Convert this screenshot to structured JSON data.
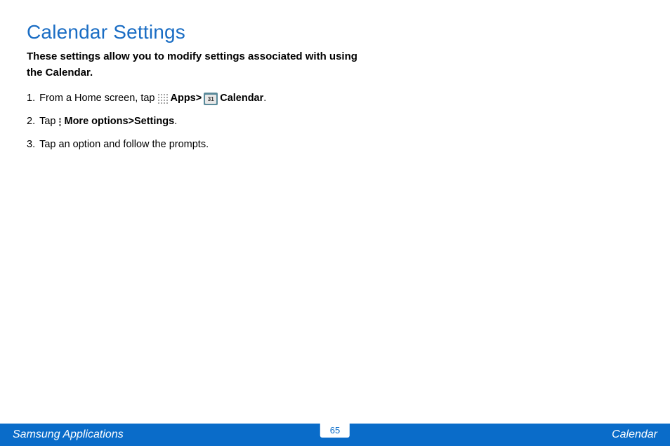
{
  "title": "Calendar Settings",
  "intro": "These settings allow you to modify settings associated with using the Calendar.",
  "steps": {
    "s1": {
      "num": "1.",
      "lead": " From a Home screen, tap ",
      "apps": "Apps",
      "gt": " > ",
      "cal_badge": "31",
      "calendar": "Calendar",
      "period": "."
    },
    "s2": {
      "num": "2.",
      "lead": " Tap ",
      "more": "More options",
      "gt": " > ",
      "settings": "Settings",
      "period": "."
    },
    "s3": {
      "num": "3.",
      "text": " Tap an option and follow the prompts."
    }
  },
  "footer": {
    "left": "Samsung Applications",
    "page": "65",
    "right": "Calendar"
  }
}
